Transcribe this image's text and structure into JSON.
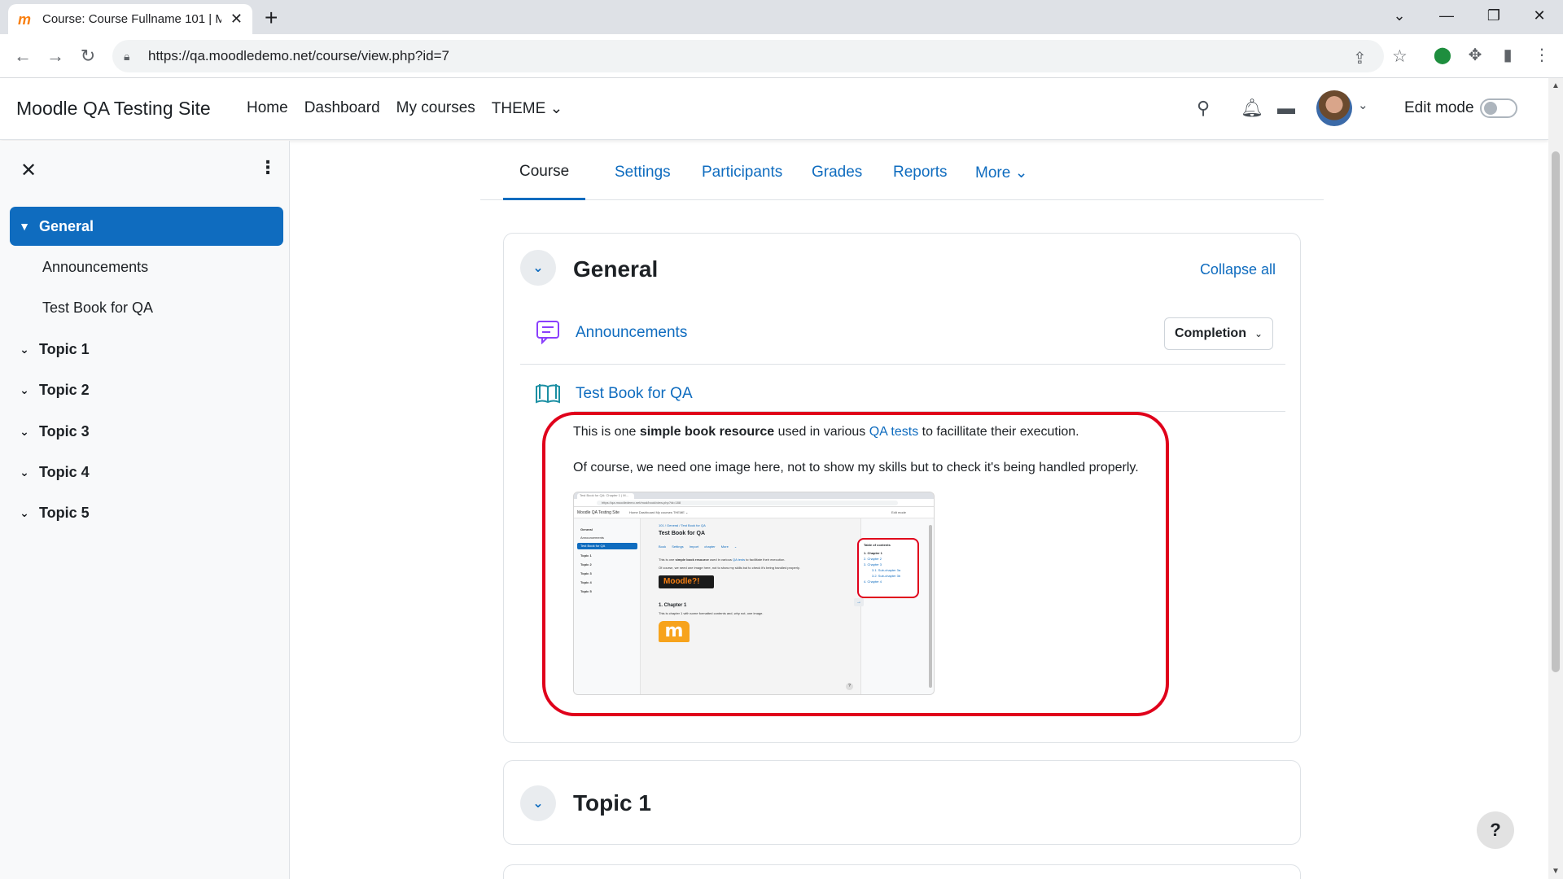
{
  "browser": {
    "tab_title": "Course: Course Fullname 101 | M",
    "tab_favicon": "m",
    "new_tab": "+",
    "url": "https://qa.moodledemo.net/course/view.php?id=7",
    "icons": [
      "back-icon",
      "forward-icon",
      "reload-icon",
      "lock-icon",
      "share-icon",
      "star-icon",
      "extension-shield-icon",
      "puzzle-icon",
      "sidepanel-icon",
      "kebab-icon"
    ],
    "window_controls": [
      "chevron-down-icon",
      "minimize-icon",
      "restore-icon",
      "close-icon"
    ]
  },
  "navbar": {
    "site_name": "Moodle QA Testing Site",
    "items": [
      {
        "label": "Home"
      },
      {
        "label": "Dashboard"
      },
      {
        "label": "My courses"
      },
      {
        "label": "THEME ⌄"
      }
    ],
    "edit_mode_label": "Edit mode",
    "edit_mode_on": false,
    "icons": [
      "search-icon",
      "bell-icon",
      "message-icon",
      "avatar",
      "chevron-down-icon"
    ]
  },
  "course_index": {
    "items": [
      {
        "label": "General",
        "type": "section",
        "active": true,
        "expanded": true
      },
      {
        "label": "Announcements",
        "type": "activity"
      },
      {
        "label": "Test Book for QA",
        "type": "activity"
      },
      {
        "label": "Topic 1",
        "type": "section"
      },
      {
        "label": "Topic 2",
        "type": "section"
      },
      {
        "label": "Topic 3",
        "type": "section"
      },
      {
        "label": "Topic 4",
        "type": "section"
      },
      {
        "label": "Topic 5",
        "type": "section"
      }
    ]
  },
  "secondary_nav": {
    "tabs": [
      {
        "label": "Course",
        "active": true
      },
      {
        "label": "Settings"
      },
      {
        "label": "Participants"
      },
      {
        "label": "Grades"
      },
      {
        "label": "Reports"
      },
      {
        "label": "More ⌄"
      }
    ]
  },
  "general_section": {
    "title": "General",
    "collapse_all": "Collapse all",
    "activities": [
      {
        "name": "Announcements",
        "icon": "forum-icon",
        "completion_label": "Completion"
      },
      {
        "name": "Test Book for QA",
        "icon": "book-icon"
      }
    ],
    "description": {
      "p1_before": "This is one ",
      "p1_bold": "simple book resource",
      "p1_mid": " used in various ",
      "p1_link": "QA tests",
      "p1_after": " to facillitate their execution.",
      "p2": "Of course, we need one image here, not to show my skills but to check it's being handled properly."
    }
  },
  "embedded_image": {
    "tab_title": "Test Book for QA: Chapter 1 | M...",
    "url": "https://qa.moodledemo.net/mod/book/view.php?id=188",
    "site_name": "Moodle QA Testing Site",
    "nav": "Home   Dashboard   My courses   THEME ⌄",
    "edit_mode": "Edit mode",
    "side_items": [
      "General",
      "Announcements",
      "Test Book for QA",
      "Topic 1",
      "Topic 2",
      "Topic 3",
      "Topic 4",
      "Topic 5"
    ],
    "breadcrumb": "101  /  General  /  Test Book for QA",
    "heading": "Test Book for QA",
    "tabs": "Book  Settings  Import chapter  More ⌄",
    "line1_before": "This is one ",
    "line1_bold": "simple book resource",
    "line1_mid": " used in various ",
    "line1_link": "QA tests",
    "line1_after": " to facillitate their execution.",
    "line2": "Of course, we need one image here, not to show my skills but to check it's being handled properly.",
    "banner": "Moodle?!",
    "chapter": "1. Chapter 1",
    "chapter_text": "This is chapter 1 with some formatted contents and, why not, one image.",
    "toc_title": "Table of contents",
    "toc_items": [
      "1. Chapter 1",
      "2. Chapter 2",
      "3. Chapter 3",
      "3.1. Sub-chapter 3a",
      "3.2. Sub-chapter 3b",
      "4. Chapter 4"
    ]
  },
  "topic1_section": {
    "title": "Topic 1"
  },
  "help_button": "?"
}
